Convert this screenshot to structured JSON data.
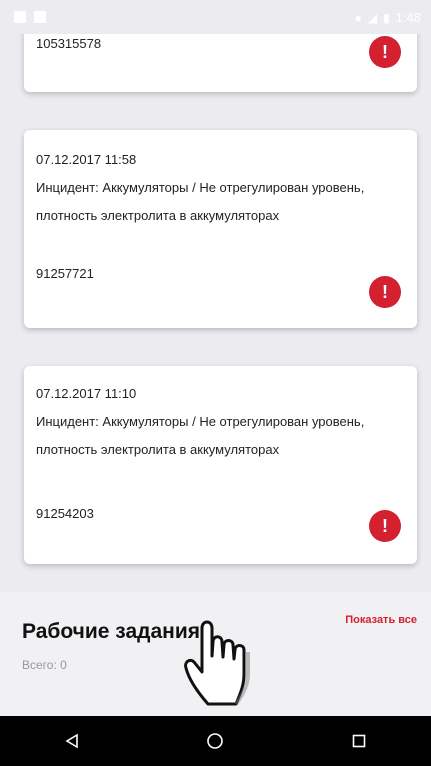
{
  "status_bar": {
    "time": "1:48"
  },
  "cards": [
    {
      "id": "105315578"
    },
    {
      "date": "07.12.2017 11:58",
      "text": "Инцидент: Аккумуляторы / Не отрегулирован уровень, плотность  электролита в аккумуляторах",
      "id": "91257721"
    },
    {
      "date": "07.12.2017 11:10",
      "text": "Инцидент: Аккумуляторы / Не отрегулирован уровень, плотность  электролита в аккумуляторах",
      "id": "91254203"
    }
  ],
  "work_tasks": {
    "title": "Рабочие задания",
    "show_all": "Показать все",
    "count_label": "Всего: 0"
  },
  "icons": {
    "alert": "alert-icon",
    "back": "back-icon",
    "home": "home-icon",
    "recents": "recents-icon",
    "cursor": "hand-pointer-icon"
  },
  "colors": {
    "accent": "#d32130",
    "background": "#ececf0",
    "card": "#ffffff",
    "navbar": "#000000"
  }
}
